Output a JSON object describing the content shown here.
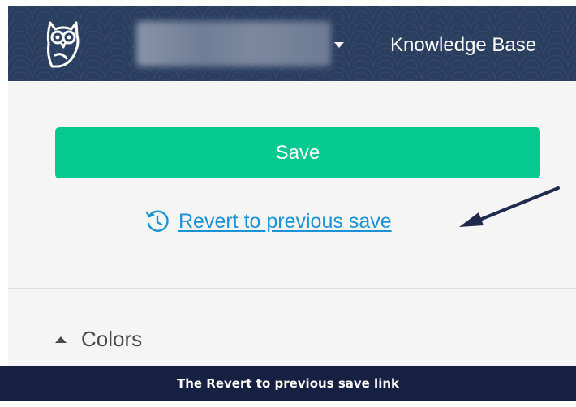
{
  "header": {
    "workspace_name": "",
    "title": "Knowledge Base",
    "logo_icon": "owl-logo-icon",
    "dropdown_icon": "caret-down-icon"
  },
  "main": {
    "save_label": "Save",
    "revert_label": "Revert to previous save",
    "revert_icon": "history-icon",
    "section_label": "Colors",
    "section_icon": "triangle-up-icon"
  },
  "caption": {
    "text": "The Revert to previous save link"
  },
  "colors": {
    "header_bg": "#2a3e60",
    "save_button": "#05c98e",
    "link": "#1d93d6",
    "caption_bg": "#152042",
    "annotation_arrow": "#1f2a4d"
  }
}
